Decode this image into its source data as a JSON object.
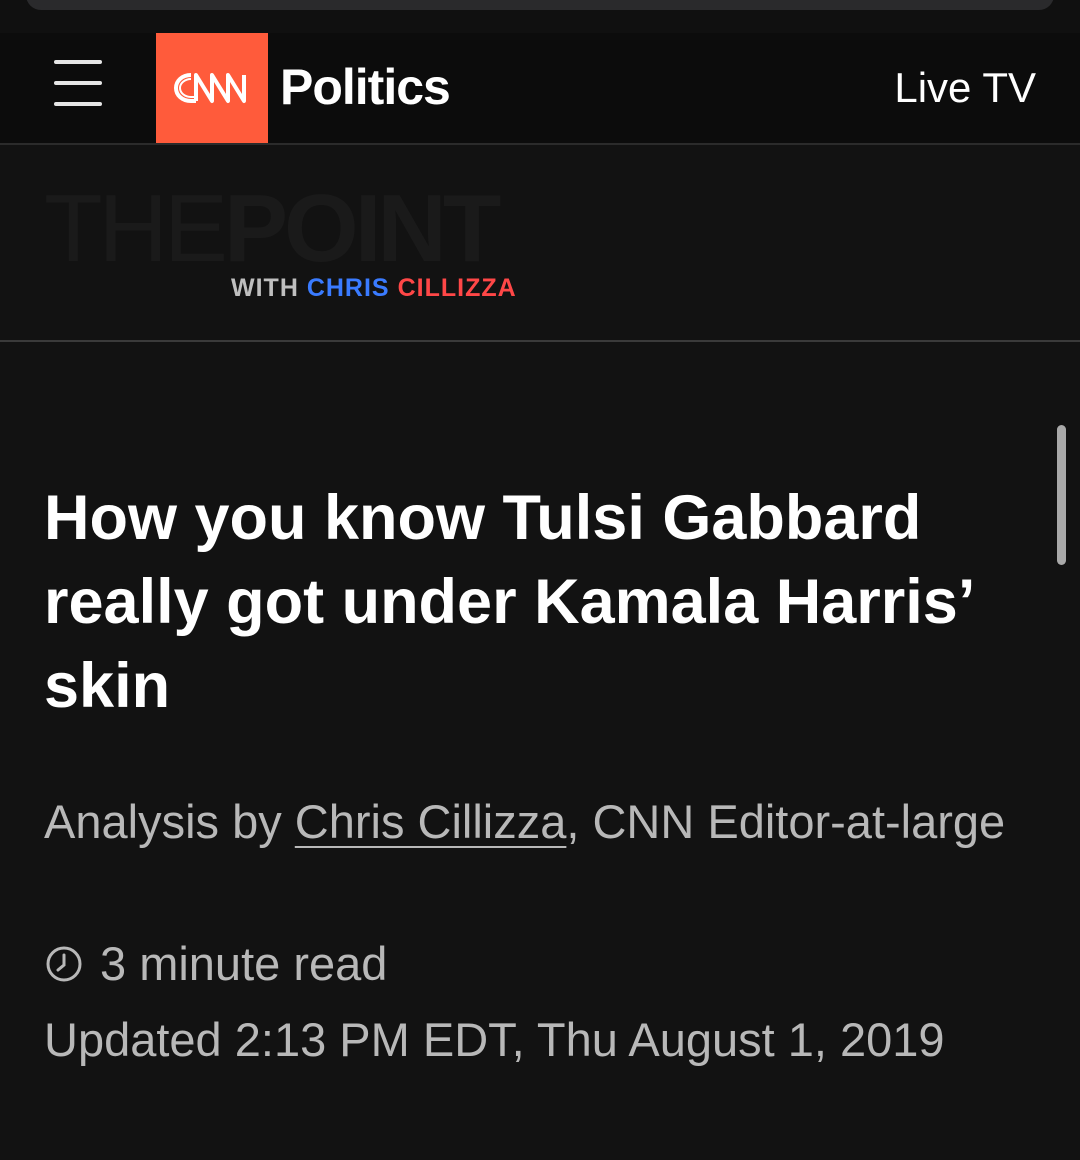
{
  "header": {
    "logo_text": "CNN",
    "section_title": "Politics",
    "live_tv_label": "Live TV"
  },
  "banner": {
    "logo_thin": "THE",
    "logo_bold": "POINT",
    "byline_with": "WITH",
    "byline_first": "CHRIS",
    "byline_last": "CILLIZZA"
  },
  "article": {
    "headline": "How you know Tulsi Gabbard really got under Kamala Harris’ skin",
    "analysis_prefix": "Analysis by ",
    "author": "Chris Cillizza",
    "author_suffix": ", CNN Editor-at-large",
    "read_time": "3 minute read",
    "updated": "Updated 2:13 PM EDT, Thu August 1, 2019"
  },
  "colors": {
    "logo_bg": "#ff5b3b",
    "byline_blue": "#3a7bff",
    "byline_red": "#ff4747",
    "background": "#121212"
  },
  "icons": {
    "menu": "hamburger-icon",
    "clock": "clock-icon"
  }
}
